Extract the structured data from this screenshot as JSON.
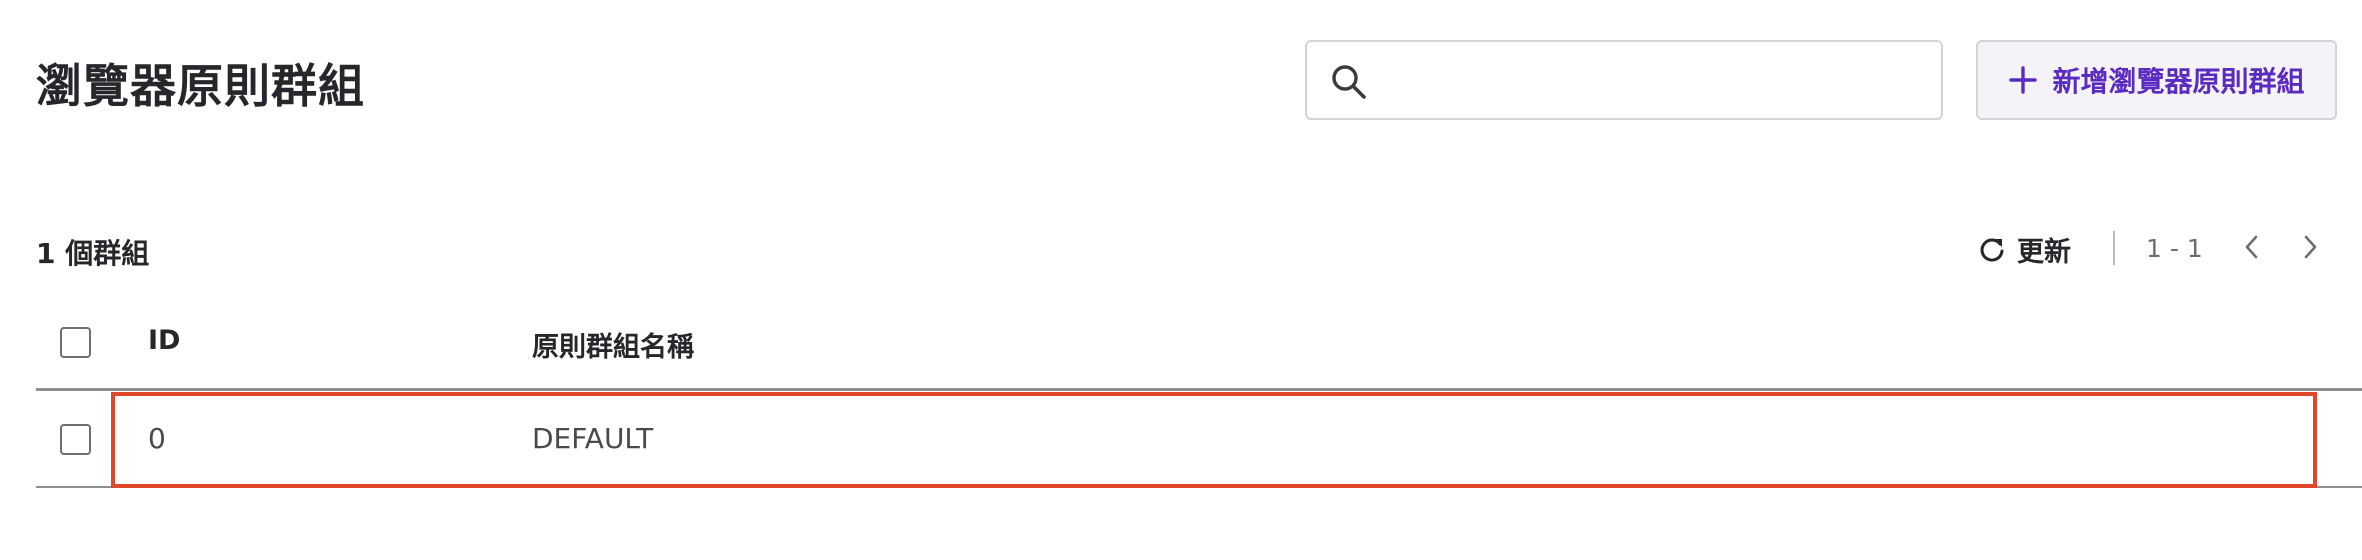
{
  "header": {
    "title": "瀏覽器原則群組",
    "search": {
      "value": "",
      "placeholder": ""
    },
    "add_button_label": "新增瀏覽器原則群組"
  },
  "toolbar": {
    "count_label": "1 個群組",
    "refresh_label": "更新",
    "page_range": "1 - 1"
  },
  "table": {
    "columns": [
      "ID",
      "原則群組名稱"
    ],
    "rows": [
      {
        "id": "0",
        "name": "DEFAULT"
      }
    ]
  },
  "colors": {
    "accent": "#5b2bc1",
    "highlight": "#e0462a"
  },
  "icons": [
    "search-icon",
    "plus-icon",
    "refresh-icon",
    "chevron-left-icon",
    "chevron-right-icon"
  ]
}
